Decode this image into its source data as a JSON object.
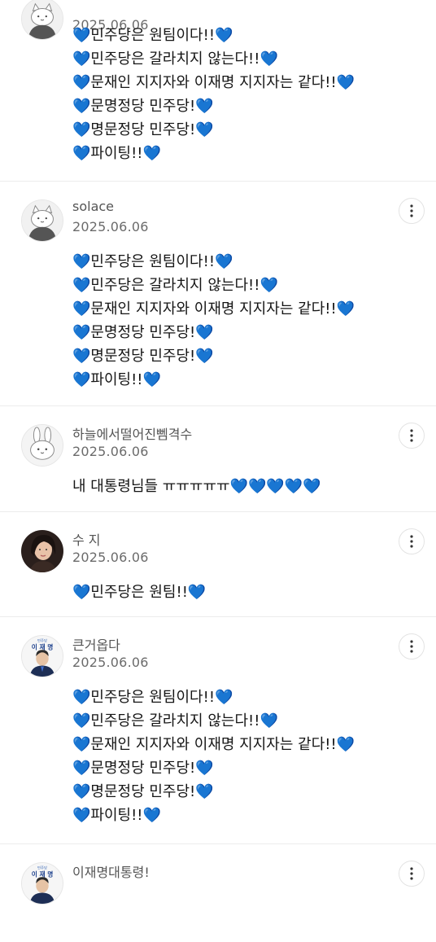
{
  "accent_heart_color": "#1e90e8",
  "comments": [
    {
      "author": "",
      "date": "2025.06.06",
      "avatar_icon": "cat-icon",
      "lines": [
        "💙민주당은 원팀이다!!💙",
        "💙민주당은 갈라치지 않는다!!💙",
        "💙문재인 지지자와 이재명 지지자는 같다!!💙",
        "💙문명정당 민주당!💙",
        "💙명문정당 민주당!💙",
        "💙파이팅!!💙"
      ]
    },
    {
      "author": "solace",
      "date": "2025.06.06",
      "avatar_icon": "cat-icon",
      "lines": [
        "💙민주당은 원팀이다!!💙",
        "💙민주당은 갈라치지 않는다!!💙",
        "💙문재인 지지자와 이재명 지지자는 같다!!💙",
        "💙문명정당 민주당!💙",
        "💙명문정당 민주당!💙",
        "💙파이팅!!💙"
      ]
    },
    {
      "author": "하늘에서떨어진뻼격수",
      "date": "2025.06.06",
      "avatar_icon": "rabbit-icon",
      "lines": [
        "내 대통령님들 ㅠㅠㅠㅠㅠ💙💙💙💙💙"
      ]
    },
    {
      "author": "수 지",
      "date": "2025.06.06",
      "avatar_icon": "person-photo-icon",
      "lines": [
        "💙민주당은 원팀!!💙"
      ]
    },
    {
      "author": "큰거옵다",
      "date": "2025.06.06",
      "avatar_icon": "politician-poster-icon",
      "lines": [
        "💙민주당은 원팀이다!!💙",
        "💙민주당은 갈라치지 않는다!!💙",
        "💙문재인 지지자와 이재명 지지자는 같다!!💙",
        "💙문명정당 민주당!💙",
        "💙명문정당 민주당!💙",
        "💙파이팅!!💙"
      ]
    },
    {
      "author": "이재명대통령!",
      "date": "",
      "avatar_icon": "politician-poster-icon",
      "lines": []
    }
  ],
  "poster_text": {
    "party": "민주당",
    "name": "이 재 명"
  }
}
